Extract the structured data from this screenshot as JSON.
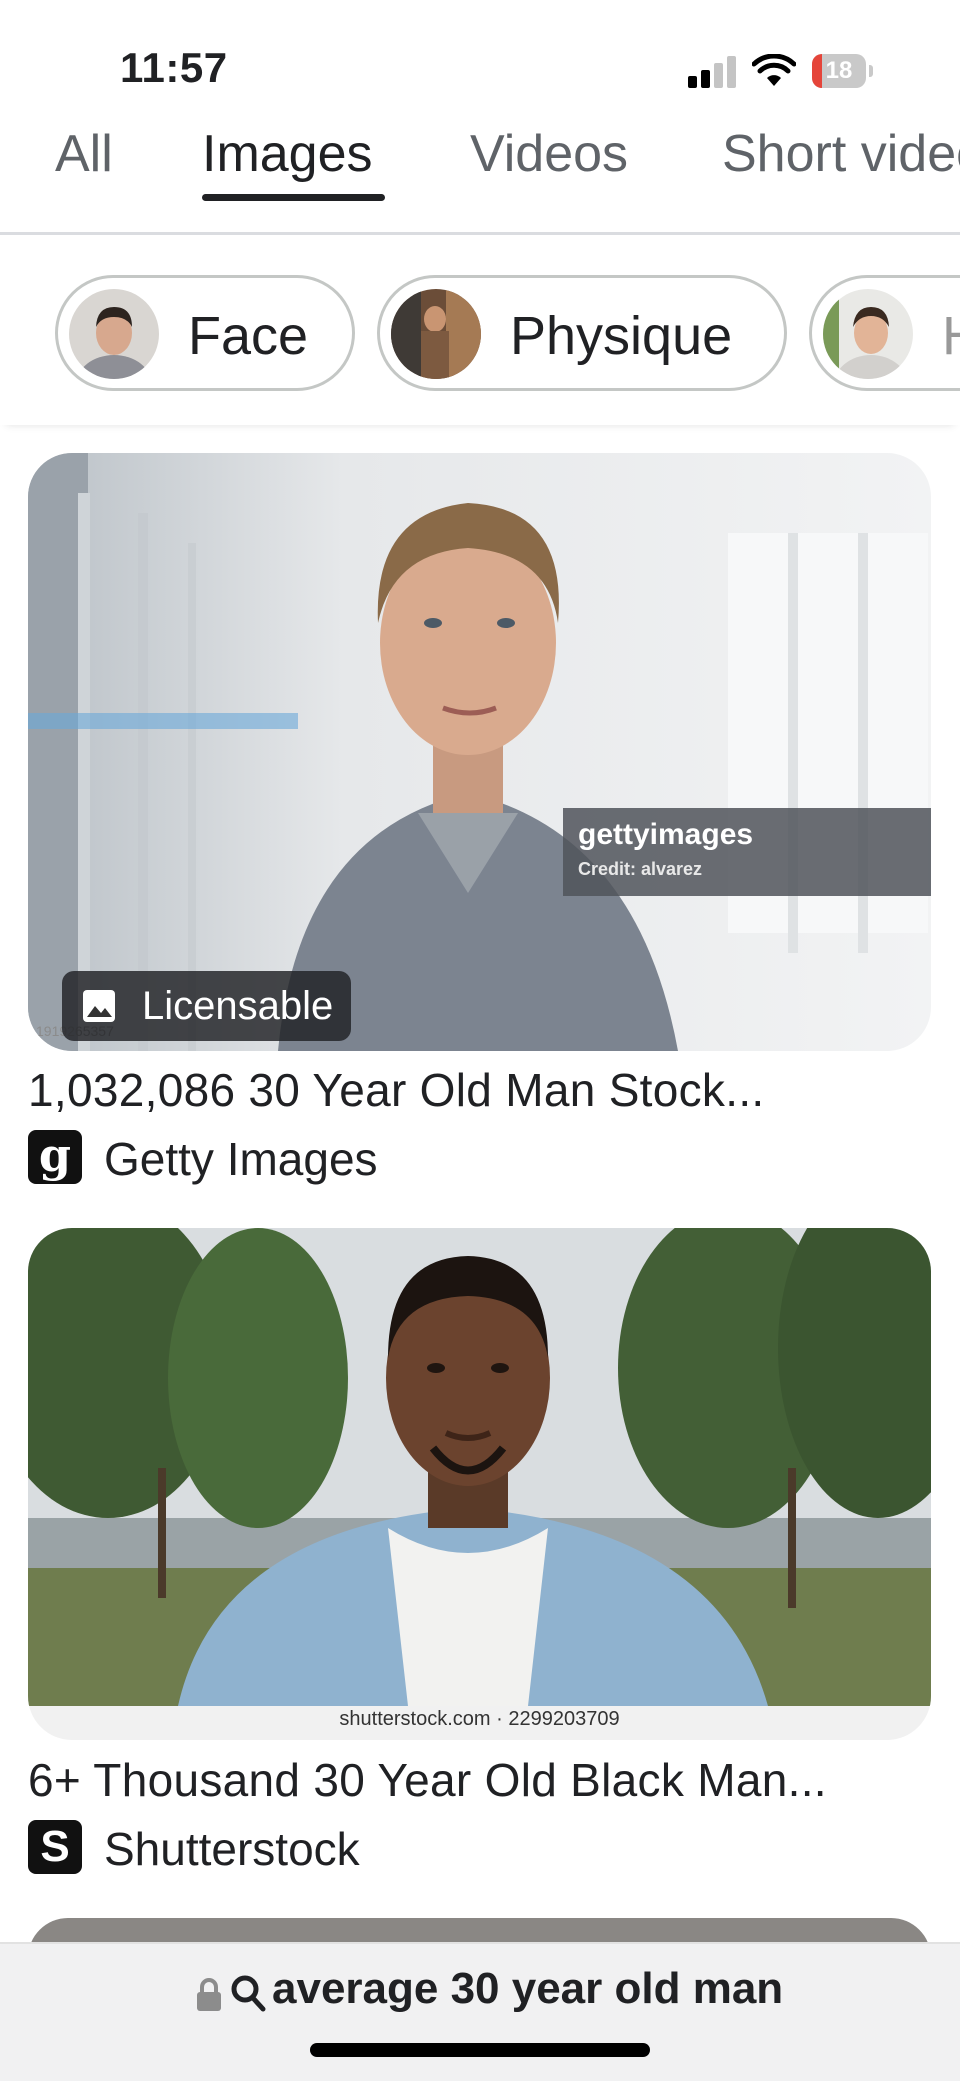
{
  "status_bar": {
    "time": "11:57",
    "battery_percent": "18",
    "battery_level": 0.18,
    "signal_bars": 2,
    "wifi_icon": "wifi-icon"
  },
  "tabs": [
    {
      "label": "All"
    },
    {
      "label": "Images",
      "active": true
    },
    {
      "label": "Videos"
    },
    {
      "label": "Short videos"
    }
  ],
  "chips": [
    {
      "label": "Face",
      "icon": "face-thumbnail"
    },
    {
      "label": "Physique",
      "icon": "physique-thumbnail"
    },
    {
      "label": "Hair",
      "icon": "hair-thumbnail"
    }
  ],
  "results": [
    {
      "title": "1,032,086 30 Year Old Man Stock...",
      "source": "Getty Images",
      "source_icon_letter": "g",
      "badge": "Licensable",
      "watermark_brand": "gettyimages",
      "watermark_credit": "Credit: alvarez",
      "image_id": "1919265357"
    },
    {
      "title": "6+ Thousand 30 Year Old Black Man...",
      "source": "Shutterstock",
      "source_icon_letter": "S",
      "watermark": "shutterstock.com · 2299203709"
    }
  ],
  "address_bar": {
    "query": "average 30 year old man",
    "lock_icon": "lock-icon",
    "search_icon": "search-icon"
  },
  "colors": {
    "accent_text": "#202124",
    "secondary_text": "#5f6368",
    "battery_low": "#e5453a"
  }
}
